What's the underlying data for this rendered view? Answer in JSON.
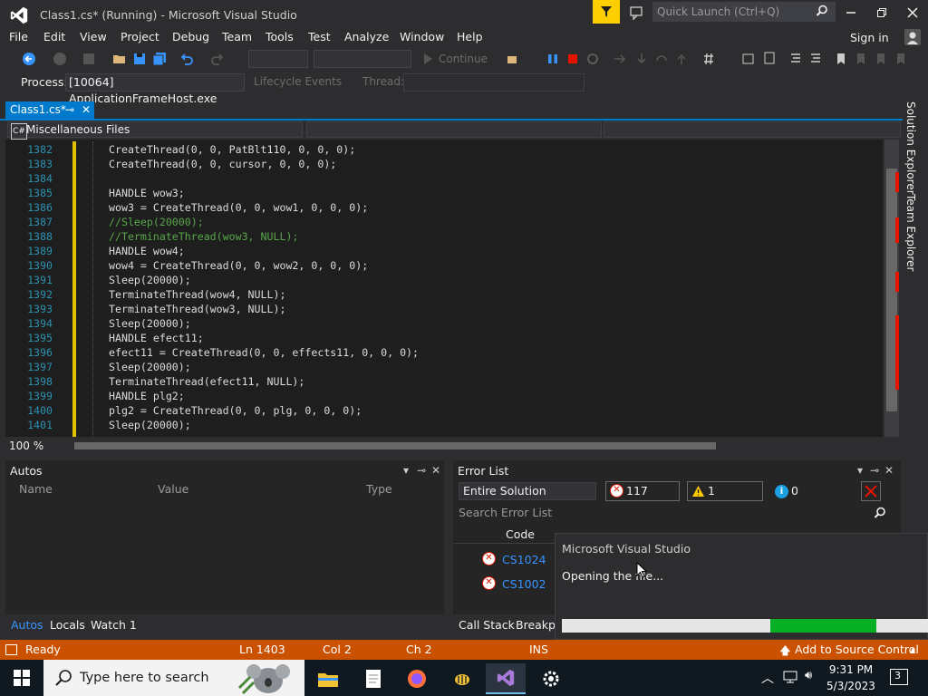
{
  "window": {
    "title": "Class1.cs* (Running) - Microsoft Visual Studio"
  },
  "quick_launch": {
    "placeholder": "Quick Launch (Ctrl+Q)"
  },
  "menu": [
    "File",
    "Edit",
    "View",
    "Project",
    "Debug",
    "Team",
    "Tools",
    "Test",
    "Analyze",
    "Window",
    "Help"
  ],
  "account": {
    "signin": "Sign in"
  },
  "toolbar": {
    "continue_label": "Continue"
  },
  "process_bar": {
    "process_label": "Process:",
    "process_value": "[10064] ApplicationFrameHost.exe",
    "lifecycle_label": "Lifecycle Events",
    "thread_label": "Thread:"
  },
  "document_tab": {
    "label": "Class1.cs*"
  },
  "nav": {
    "project": "Miscellaneous Files"
  },
  "editor": {
    "zoom": "100 %",
    "lines": [
      {
        "num": "1382",
        "text": "CreateThread(0, 0, PatBlt110, 0, 0, 0);",
        "comment": false
      },
      {
        "num": "1383",
        "text": "CreateThread(0, 0, cursor, 0, 0, 0);",
        "comment": false
      },
      {
        "num": "1384",
        "text": "",
        "comment": false
      },
      {
        "num": "1385",
        "text": "HANDLE wow3;",
        "comment": false
      },
      {
        "num": "1386",
        "text": "wow3 = CreateThread(0, 0, wow1, 0, 0, 0);",
        "comment": false
      },
      {
        "num": "1387",
        "text": "//Sleep(20000);",
        "comment": true
      },
      {
        "num": "1388",
        "text": "//TerminateThread(wow3, NULL);",
        "comment": true
      },
      {
        "num": "1389",
        "text": "HANDLE wow4;",
        "comment": false
      },
      {
        "num": "1390",
        "text": "wow4 = CreateThread(0, 0, wow2, 0, 0, 0);",
        "comment": false
      },
      {
        "num": "1391",
        "text": "Sleep(20000);",
        "comment": false
      },
      {
        "num": "1392",
        "text": "TerminateThread(wow4, NULL);",
        "comment": false
      },
      {
        "num": "1393",
        "text": "TerminateThread(wow3, NULL);",
        "comment": false
      },
      {
        "num": "1394",
        "text": "Sleep(20000);",
        "comment": false
      },
      {
        "num": "1395",
        "text": "HANDLE efect11;",
        "comment": false
      },
      {
        "num": "1396",
        "text": "efect11 = CreateThread(0, 0, effects11, 0, 0, 0);",
        "comment": false
      },
      {
        "num": "1397",
        "text": "Sleep(20000);",
        "comment": false
      },
      {
        "num": "1398",
        "text": "TerminateThread(efect11, NULL);",
        "comment": false
      },
      {
        "num": "1399",
        "text": "HANDLE plg2;",
        "comment": false
      },
      {
        "num": "1400",
        "text": "plg2 = CreateThread(0, 0, plg, 0, 0, 0);",
        "comment": false
      },
      {
        "num": "1401",
        "text": "Sleep(20000);",
        "comment": false
      }
    ]
  },
  "side_tabs": {
    "solution_explorer": "Solution Explorer",
    "team_explorer": "Team Explorer"
  },
  "autos": {
    "title": "Autos",
    "columns": [
      "Name",
      "Value",
      "Type"
    ],
    "tabs": [
      "Autos",
      "Locals",
      "Watch 1"
    ]
  },
  "error_list": {
    "title": "Error List",
    "scope": "Entire Solution",
    "errors_label": "117 Errors",
    "warnings_label": "1 Warning",
    "messages_label": "0 Messages",
    "search_placeholder": "Search Error List",
    "code_header": "Code",
    "rows": [
      {
        "code": "CS1024"
      },
      {
        "code": "CS1002"
      }
    ],
    "tabs": [
      "Call Stack",
      "Breakpo"
    ]
  },
  "popup": {
    "title": "Microsoft Visual Studio",
    "message": "Opening the file...",
    "progress": 0.29,
    "progress_offset": 0.57
  },
  "status": {
    "ready": "Ready",
    "line": "Ln 1403",
    "col": "Col 2",
    "ch": "Ch 2",
    "ins": "INS",
    "source_control": "Add to Source Control",
    "color": "#ca5100"
  },
  "taskbar": {
    "search_placeholder": "Type here to search",
    "time": "9:31 PM",
    "date": "5/3/2023",
    "notification_count": "3"
  },
  "colors": {
    "accent": "#007acc",
    "error": "#e51400",
    "progress": "#06b025"
  }
}
